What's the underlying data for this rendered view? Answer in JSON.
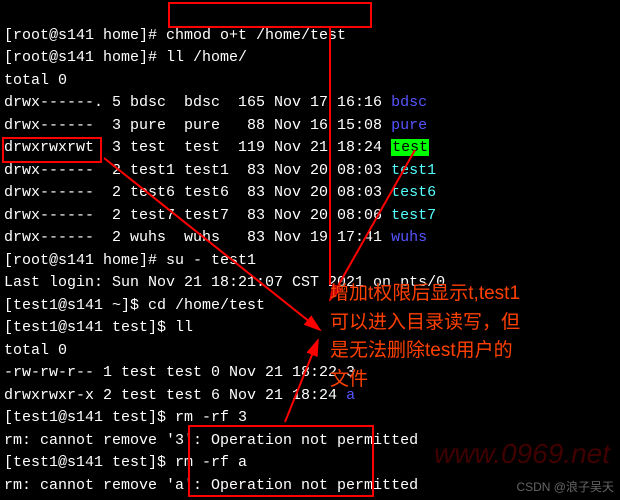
{
  "lines": {
    "l1_prompt": "[root@s141 home]# ",
    "l1_cmd": "chmod o+t /home/test",
    "l2_prompt": "[root@s141 home]# ",
    "l2_cmd": "ll /home/",
    "l3": "total 0",
    "l4_perm": "drwx------. 5 bdsc  bdsc  165 Nov 17 16:16 ",
    "l4_name": "bdsc",
    "l5_perm": "drwx------  3 pure  pure   88 Nov 16 15:08 ",
    "l5_name": "pure",
    "l6_perm": "drwxrwxrwt",
    "l6_rest": "  3 test  test  119 Nov 21 18:24 ",
    "l6_name": "test",
    "l7_perm": "drwx------  2 test1 test1  83 Nov 20 08:03 ",
    "l7_name": "test1",
    "l8_perm": "drwx------  2 test6 test6  83 Nov 20 08:03 ",
    "l8_name": "test6",
    "l9_perm": "drwx------  2 test7 test7  83 Nov 20 08:06 ",
    "l9_name": "test7",
    "l10_perm": "drwx------  2 wuhs  wuhs   83 Nov 19 17:41 ",
    "l10_name": "wuhs",
    "l11_prompt": "[root@s141 home]# ",
    "l11_cmd": "su - test1",
    "l12": "Last login: Sun Nov 21 18:21:07 CST 2021 on pts/0",
    "l13_prompt": "[test1@s141 ~]$ ",
    "l13_cmd": "cd /home/test",
    "l14_prompt": "[test1@s141 test]$ ",
    "l14_cmd": "ll",
    "l15": "total 0",
    "l16": "-rw-rw-r-- 1 test test 0 Nov 21 18:22 3",
    "l17_perm": "drwxrwxr-x 2 test test 6 Nov 21 18:24 ",
    "l17_name": "a",
    "l18_prompt": "[test1@s141 test]$ ",
    "l18_cmd": "rm -rf 3",
    "l19": "rm: cannot remove '3': Operation not permitted",
    "l20_prompt": "[test1@s141 test]$ ",
    "l20_cmd": "rm -rf a",
    "l21": "rm: cannot remove 'a': Operation not permitted"
  },
  "annotation": {
    "line1": "增加t权限后显示t,test1",
    "line2": "可以进入目录读写，但",
    "line3": "是无法删除test用户的",
    "line4": "文件"
  },
  "watermark": {
    "url": "www.0969.net",
    "csdn": "CSDN @浪子吴天"
  }
}
